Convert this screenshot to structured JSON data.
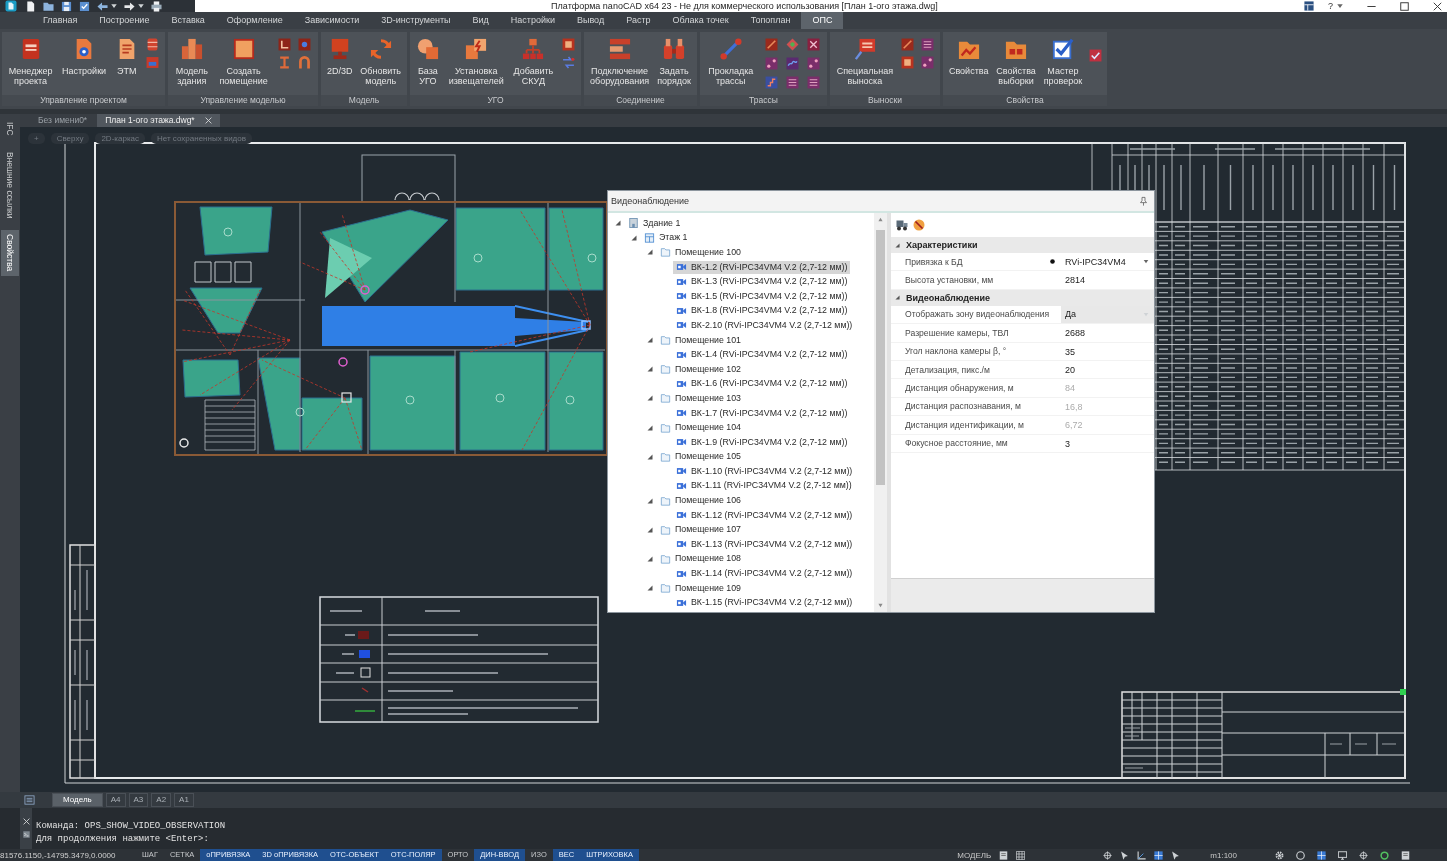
{
  "window": {
    "title": "Платформа nanoCAD x64 23 - Не для коммерческого использования [План 1-ого этажа.dwg]",
    "help": "?"
  },
  "menu_tabs": [
    {
      "label": "Главная",
      "selected": false
    },
    {
      "label": "Построение",
      "selected": false
    },
    {
      "label": "Вставка",
      "selected": false
    },
    {
      "label": "Оформление",
      "selected": false
    },
    {
      "label": "Зависимости",
      "selected": false
    },
    {
      "label": "3D-инструменты",
      "selected": false
    },
    {
      "label": "Вид",
      "selected": false
    },
    {
      "label": "Настройки",
      "selected": false
    },
    {
      "label": "Вывод",
      "selected": false
    },
    {
      "label": "Растр",
      "selected": false
    },
    {
      "label": "Облака точек",
      "selected": false
    },
    {
      "label": "Топоплан",
      "selected": false
    },
    {
      "label": "ОПС",
      "selected": true
    }
  ],
  "ribbon": {
    "groups": [
      {
        "caption": "Управление проектом",
        "buttons": [
          {
            "label": "Менеджер проекта"
          },
          {
            "label": "Настройки"
          },
          {
            "label": "ЭТМ"
          }
        ]
      },
      {
        "caption": "Управление моделью",
        "buttons": [
          {
            "label": "Модель здания"
          },
          {
            "label": "Создать помещение"
          }
        ]
      },
      {
        "caption": "Модель",
        "buttons": [
          {
            "label": "2D/3D"
          },
          {
            "label": "Обновить модель"
          }
        ]
      },
      {
        "caption": "УГО",
        "buttons": [
          {
            "label": "База УГО"
          },
          {
            "label": "Установка извещателей"
          },
          {
            "label": "Добавить СКУД"
          }
        ]
      },
      {
        "caption": "Соединение",
        "buttons": [
          {
            "label": "Подключение оборудования"
          },
          {
            "label": "Задать порядок"
          }
        ]
      },
      {
        "caption": "Трассы",
        "buttons": [
          {
            "label": "Прокладка трассы"
          }
        ]
      },
      {
        "caption": "Выноски",
        "buttons": [
          {
            "label": "Специальная выноска"
          }
        ]
      },
      {
        "caption": "Свойства",
        "buttons": [
          {
            "label": "Свойства"
          },
          {
            "label": "Свойства выборки"
          },
          {
            "label": "Мастер проверок"
          }
        ]
      }
    ]
  },
  "side_panel": {
    "tabs": [
      {
        "label": "IFC",
        "selected": false
      },
      {
        "label": "Внешние ссылки",
        "selected": false
      },
      {
        "label": "Свойства",
        "selected": true
      }
    ]
  },
  "document_tabs": [
    {
      "label": "Без имени0*",
      "selected": false
    },
    {
      "label": "План 1-ого этажа.dwg*",
      "selected": true
    }
  ],
  "viewport_controls": [
    "+",
    "Сверху",
    "2D-каркас",
    "Нет сохраненных видов"
  ],
  "video_panel": {
    "title": "Видеонаблюдение",
    "tree": [
      {
        "label": "Здание 1",
        "kind": "building",
        "selected": false,
        "expanded": true,
        "children": [
          {
            "label": "Этаж 1",
            "kind": "floor",
            "selected": false,
            "expanded": true,
            "children": [
              {
                "label": "Помещение 100",
                "kind": "room",
                "selected": false,
                "expanded": true,
                "children": [
                  {
                    "label": "ВК-1.2 (RVi-IPC34VM4 V.2 (2,7-12 мм))",
                    "kind": "camera",
                    "selected": true
                  },
                  {
                    "label": "ВК-1.3 (RVi-IPC34VM4 V.2 (2,7-12 мм))",
                    "kind": "camera",
                    "selected": false
                  },
                  {
                    "label": "ВК-1.5 (RVi-IPC34VM4 V.2 (2,7-12 мм))",
                    "kind": "camera",
                    "selected": false
                  },
                  {
                    "label": "ВК-1.8 (RVi-IPC34VM4 V.2 (2,7-12 мм))",
                    "kind": "camera",
                    "selected": false
                  },
                  {
                    "label": "ВК-2.10 (RVi-IPC34VM4 V.2 (2,7-12 мм))",
                    "kind": "camera",
                    "selected": false
                  }
                ]
              },
              {
                "label": "Помещение 101",
                "kind": "room",
                "selected": false,
                "expanded": true,
                "children": [
                  {
                    "label": "ВК-1.4 (RVi-IPC34VM4 V.2 (2,7-12 мм))",
                    "kind": "camera",
                    "selected": false
                  }
                ]
              },
              {
                "label": "Помещение 102",
                "kind": "room",
                "selected": false,
                "expanded": true,
                "children": [
                  {
                    "label": "ВК-1.6 (RVi-IPC34VM4 V.2 (2,7-12 мм))",
                    "kind": "camera",
                    "selected": false
                  }
                ]
              },
              {
                "label": "Помещение 103",
                "kind": "room",
                "selected": false,
                "expanded": true,
                "children": [
                  {
                    "label": "ВК-1.7 (RVi-IPC34VM4 V.2 (2,7-12 мм))",
                    "kind": "camera",
                    "selected": false
                  }
                ]
              },
              {
                "label": "Помещение 104",
                "kind": "room",
                "selected": false,
                "expanded": true,
                "children": [
                  {
                    "label": "ВК-1.9 (RVi-IPC34VM4 V.2 (2,7-12 мм))",
                    "kind": "camera",
                    "selected": false
                  }
                ]
              },
              {
                "label": "Помещение 105",
                "kind": "room",
                "selected": false,
                "expanded": true,
                "children": [
                  {
                    "label": "ВК-1.10 (RVi-IPC34VM4 V.2 (2,7-12 мм))",
                    "kind": "camera",
                    "selected": false
                  },
                  {
                    "label": "ВК-1.11 (RVi-IPC34VM4 V.2 (2,7-12 мм))",
                    "kind": "camera",
                    "selected": false
                  }
                ]
              },
              {
                "label": "Помещение 106",
                "kind": "room",
                "selected": false,
                "expanded": true,
                "children": [
                  {
                    "label": "ВК-1.12 (RVi-IPC34VM4 V.2 (2,7-12 мм))",
                    "kind": "camera",
                    "selected": false
                  }
                ]
              },
              {
                "label": "Помещение 107",
                "kind": "room",
                "selected": false,
                "expanded": true,
                "children": [
                  {
                    "label": "ВК-1.13 (RVi-IPC34VM4 V.2 (2,7-12 мм))",
                    "kind": "camera",
                    "selected": false
                  }
                ]
              },
              {
                "label": "Помещение 108",
                "kind": "room",
                "selected": false,
                "expanded": true,
                "children": [
                  {
                    "label": "ВК-1.14 (RVi-IPC34VM4 V.2 (2,7-12 мм))",
                    "kind": "camera",
                    "selected": false
                  }
                ]
              },
              {
                "label": "Помещение 109",
                "kind": "room",
                "selected": false,
                "expanded": true,
                "children": [
                  {
                    "label": "ВК-1.15 (RVi-IPC34VM4 V.2 (2,7-12 мм))",
                    "kind": "camera",
                    "selected": false
                  }
                ]
              }
            ]
          }
        ]
      }
    ],
    "properties": {
      "sections": [
        {
          "title": "Характеристики",
          "expanded": true,
          "rows": [
            {
              "name": "Привязка к БД",
              "value": "RVi-IPC34VM4",
              "kind": "db-link",
              "disabled": false
            },
            {
              "name": "Высота установки, мм",
              "value": "2814",
              "kind": "text",
              "disabled": false
            }
          ]
        },
        {
          "title": "Видеонаблюдение",
          "expanded": true,
          "rows": [
            {
              "name": "Отображать зону видеонаблюдения",
              "value": "Да",
              "kind": "dropdown",
              "disabled": false
            },
            {
              "name": "Разрешение камеры, ТВЛ",
              "value": "2688",
              "kind": "text",
              "disabled": false
            },
            {
              "name": "Угол наклона камеры β, °",
              "value": "35",
              "kind": "text",
              "disabled": false
            },
            {
              "name": "Детализация, пикс./м",
              "value": "20",
              "kind": "text",
              "disabled": false
            },
            {
              "name": "Дистанция обнаружения, м",
              "value": "84",
              "kind": "text",
              "disabled": true
            },
            {
              "name": "Дистанция распознавания, м",
              "value": "16,8",
              "kind": "text",
              "disabled": true
            },
            {
              "name": "Дистанция идентификации, м",
              "value": "6,72",
              "kind": "text",
              "disabled": true
            },
            {
              "name": "Фокусное расстояние, мм",
              "value": "3",
              "kind": "text",
              "disabled": false
            }
          ]
        }
      ]
    }
  },
  "layout_tabs": [
    {
      "label": "Модель",
      "selected": true
    },
    {
      "label": "A4",
      "selected": false
    },
    {
      "label": "A3",
      "selected": false
    },
    {
      "label": "A2",
      "selected": false
    },
    {
      "label": "A1",
      "selected": false
    }
  ],
  "command_line": {
    "lines": [
      "Команда: OPS_SHOW_VIDEO_OBSERVATION",
      "Для продолжения нажмите <Enter>:"
    ]
  },
  "status_bar": {
    "coordinates": "81576.1150,-14795.3479,0.0000",
    "toggles": [
      {
        "label": "ШАГ",
        "on": false
      },
      {
        "label": "СЕТКА",
        "on": false
      },
      {
        "label": "оПРИВЯЗКА",
        "on": true
      },
      {
        "label": "3D оПРИВЯЗКА",
        "on": true
      },
      {
        "label": "ОТС-ОБЪЕКТ",
        "on": true
      },
      {
        "label": "ОТС-ПОЛЯР",
        "on": true
      },
      {
        "label": "ОРТО",
        "on": false
      },
      {
        "label": "ДИН-ВВОД",
        "on": true
      },
      {
        "label": "ИЗО",
        "on": false
      },
      {
        "label": "ВЕС",
        "on": true
      },
      {
        "label": "ШТРИХОВКА",
        "on": true
      }
    ],
    "space": "МОДЕЛЬ",
    "scale": "m1:100"
  }
}
